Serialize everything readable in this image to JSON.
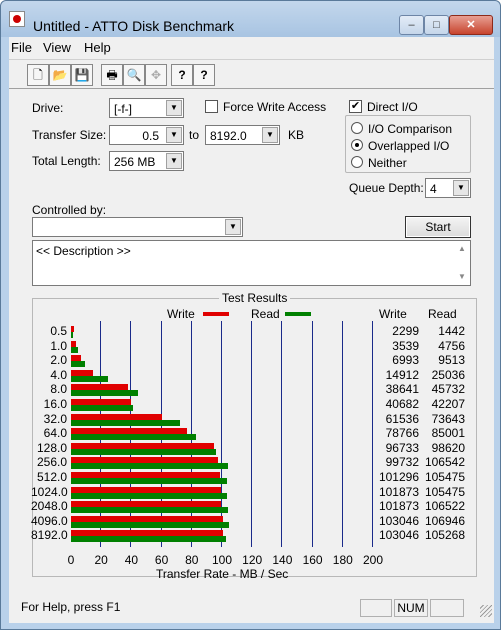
{
  "window": {
    "title": "Untitled - ATTO Disk Benchmark",
    "min": "–",
    "max": "□",
    "close": "✕"
  },
  "menu": [
    "File",
    "View",
    "Help"
  ],
  "toolbar": [
    {
      "name": "new-icon",
      "glyph": "🗋"
    },
    {
      "name": "open-icon",
      "glyph": "📂"
    },
    {
      "name": "save-icon",
      "glyph": "💾"
    },
    {
      "name": "print-icon",
      "glyph": "🖶"
    },
    {
      "name": "print-preview-icon",
      "glyph": "🔍"
    },
    {
      "name": "move-icon",
      "glyph": "✥"
    },
    {
      "name": "help-icon",
      "glyph": "?"
    },
    {
      "name": "context-help-icon",
      "glyph": "?"
    }
  ],
  "form": {
    "drive_label": "Drive:",
    "drive_value": "[-f-]",
    "force_write_label": "Force Write Access",
    "direct_io_label": "Direct I/O",
    "direct_io_checked": "✔",
    "transfer_size_label": "Transfer Size:",
    "transfer_from": "0.5",
    "to_label": "to",
    "transfer_to": "8192.0",
    "kb_label": "KB",
    "total_length_label": "Total Length:",
    "total_length_value": "256 MB",
    "radio_io_comparison": "I/O Comparison",
    "radio_overlapped": "Overlapped I/O",
    "radio_neither": "Neither",
    "queue_depth_label": "Queue Depth:",
    "queue_depth_value": "4",
    "controlled_by_label": "Controlled by:",
    "controlled_by_value": "",
    "start_label": "Start",
    "description": "<< Description >>"
  },
  "results": {
    "title": "Test Results",
    "write_legend": "Write",
    "read_legend": "Read",
    "write_col": "Write",
    "read_col": "Read",
    "xlabel": "Transfer Rate - MB / Sec",
    "write_color": "#e00000",
    "read_color": "#008000"
  },
  "chart_data": {
    "type": "bar",
    "orientation": "horizontal",
    "title": "Test Results",
    "xlabel": "Transfer Rate - MB / Sec",
    "xlim": [
      0,
      200
    ],
    "xticks": [
      "0",
      "20",
      "40",
      "60",
      "80",
      "100",
      "120",
      "140",
      "160",
      "180",
      "200"
    ],
    "categories": [
      "0.5",
      "1.0",
      "2.0",
      "4.0",
      "8.0",
      "16.0",
      "32.0",
      "64.0",
      "128.0",
      "256.0",
      "512.0",
      "1024.0",
      "2048.0",
      "4096.0",
      "8192.0"
    ],
    "series": [
      {
        "name": "Write",
        "values": [
          2299,
          3539,
          6993,
          14912,
          38641,
          40682,
          61536,
          78766,
          96733,
          99732,
          101296,
          101873,
          101873,
          103046,
          103046
        ]
      },
      {
        "name": "Read",
        "values": [
          1442,
          4756,
          9513,
          25036,
          45732,
          42207,
          73643,
          85001,
          98620,
          106542,
          105475,
          105475,
          106522,
          106946,
          105268
        ]
      }
    ],
    "grid": true,
    "legend": "top-center"
  },
  "status": {
    "help_text": "For Help, press F1",
    "num": "NUM"
  }
}
